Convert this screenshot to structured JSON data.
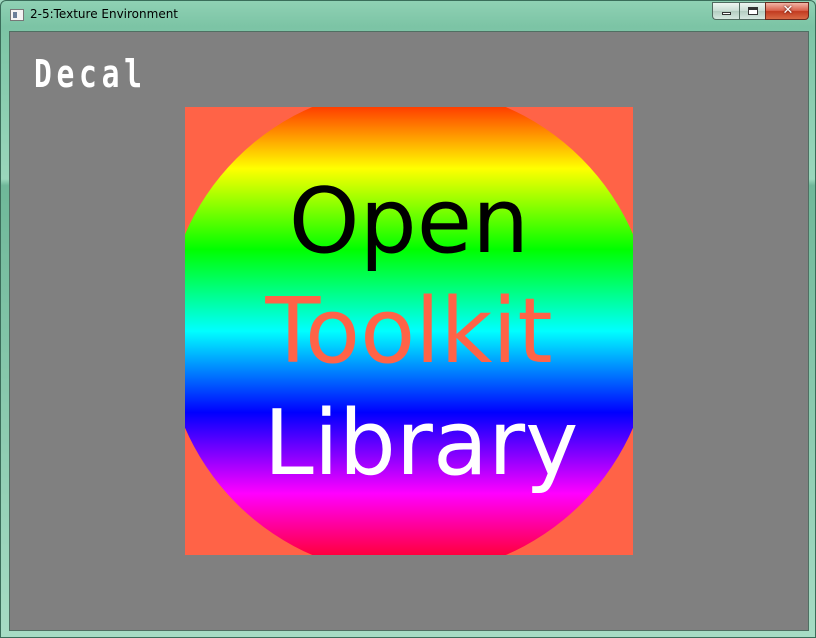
{
  "window": {
    "title": "2-5:Texture Environment",
    "controls": {
      "minimize": "",
      "maximize": "",
      "close": "✕"
    }
  },
  "scene": {
    "mode_label": "Decal",
    "texture_lines": [
      "Open",
      "Toolkit",
      "Library"
    ],
    "colors": {
      "background": "#808080",
      "quad": "#ff6347",
      "line1": "#000000",
      "line2": "#ff6347",
      "line3": "#ffffff"
    }
  }
}
